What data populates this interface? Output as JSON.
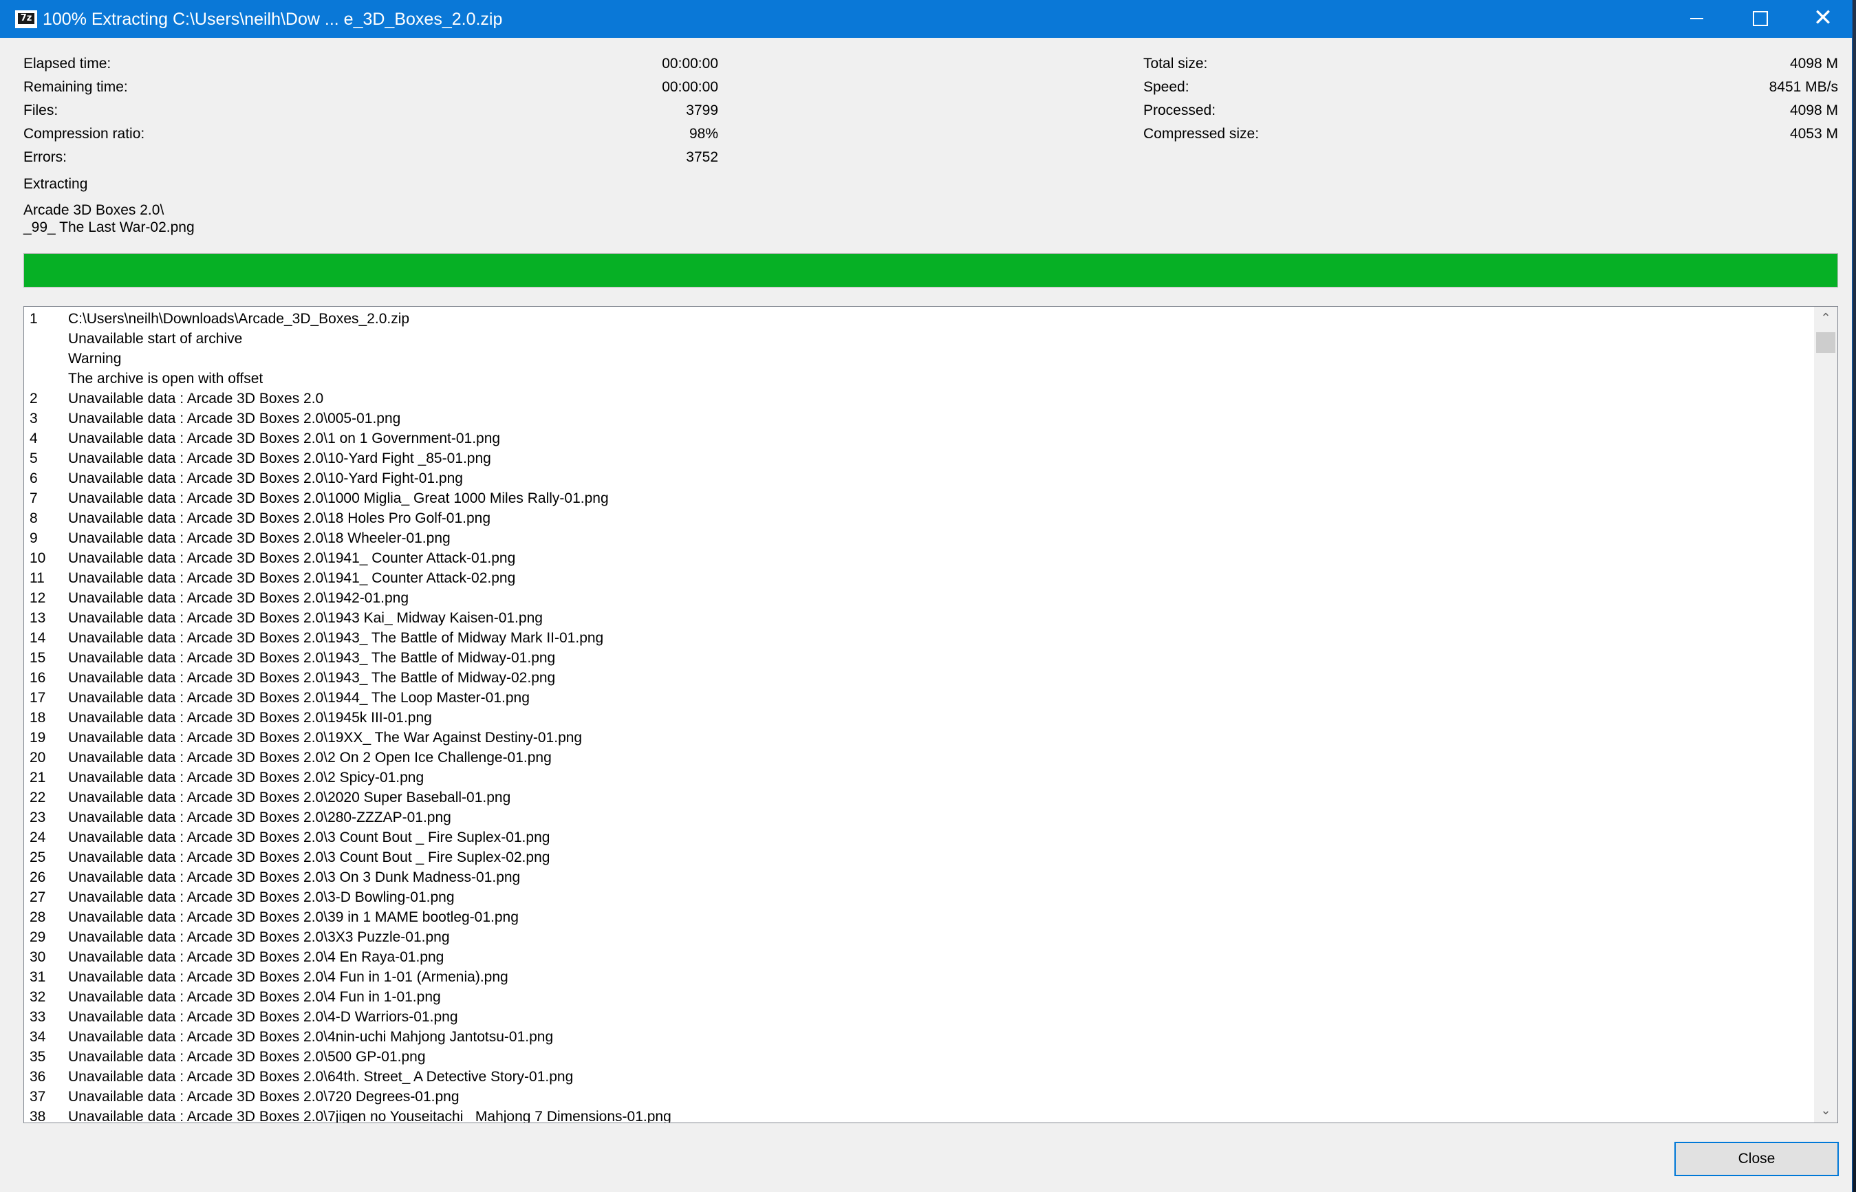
{
  "window": {
    "title": "100% Extracting C:\\Users\\neilh\\Dow ... e_3D_Boxes_2.0.zip",
    "app_icon_text": "7z",
    "icons": {
      "minimize": "minimize-icon",
      "maximize": "maximize-icon",
      "close": "close-icon"
    },
    "close_glyph": "✕"
  },
  "stats_left": [
    {
      "label": "Elapsed time:",
      "value": "00:00:00"
    },
    {
      "label": "Remaining time:",
      "value": "00:00:00"
    },
    {
      "label": "Files:",
      "value": "3799"
    },
    {
      "label": "Compression ratio:",
      "value": "98%"
    },
    {
      "label": "Errors:",
      "value": "3752"
    }
  ],
  "stats_right": [
    {
      "label": "Total size:",
      "value": "4098 M"
    },
    {
      "label": "Speed:",
      "value": "8451 MB/s"
    },
    {
      "label": "Processed:",
      "value": "4098 M"
    },
    {
      "label": "Compressed size:",
      "value": "4053 M"
    }
  ],
  "status": {
    "operation": "Extracting",
    "current_folder": "Arcade 3D Boxes 2.0\\",
    "current_file": "_99_ The Last War-02.png"
  },
  "progress": {
    "fraction": 1.0,
    "color": "#06b025"
  },
  "log": [
    {
      "num": "1",
      "msg": "C:\\Users\\neilh\\Downloads\\Arcade_3D_Boxes_2.0.zip"
    },
    {
      "num": "",
      "msg": "Unavailable start of archive"
    },
    {
      "num": "",
      "msg": "Warning"
    },
    {
      "num": "",
      "msg": "The archive is open with offset"
    },
    {
      "num": "2",
      "msg": "Unavailable data : Arcade 3D Boxes 2.0"
    },
    {
      "num": "3",
      "msg": "Unavailable data : Arcade 3D Boxes 2.0\\005-01.png"
    },
    {
      "num": "4",
      "msg": "Unavailable data : Arcade 3D Boxes 2.0\\1 on 1 Government-01.png"
    },
    {
      "num": "5",
      "msg": "Unavailable data : Arcade 3D Boxes 2.0\\10-Yard Fight _85-01.png"
    },
    {
      "num": "6",
      "msg": "Unavailable data : Arcade 3D Boxes 2.0\\10-Yard Fight-01.png"
    },
    {
      "num": "7",
      "msg": "Unavailable data : Arcade 3D Boxes 2.0\\1000 Miglia_ Great 1000 Miles Rally-01.png"
    },
    {
      "num": "8",
      "msg": "Unavailable data : Arcade 3D Boxes 2.0\\18 Holes Pro Golf-01.png"
    },
    {
      "num": "9",
      "msg": "Unavailable data : Arcade 3D Boxes 2.0\\18 Wheeler-01.png"
    },
    {
      "num": "10",
      "msg": "Unavailable data : Arcade 3D Boxes 2.0\\1941_ Counter Attack-01.png"
    },
    {
      "num": "11",
      "msg": "Unavailable data : Arcade 3D Boxes 2.0\\1941_ Counter Attack-02.png"
    },
    {
      "num": "12",
      "msg": "Unavailable data : Arcade 3D Boxes 2.0\\1942-01.png"
    },
    {
      "num": "13",
      "msg": "Unavailable data : Arcade 3D Boxes 2.0\\1943 Kai_ Midway Kaisen-01.png"
    },
    {
      "num": "14",
      "msg": "Unavailable data : Arcade 3D Boxes 2.0\\1943_ The Battle of Midway Mark II-01.png"
    },
    {
      "num": "15",
      "msg": "Unavailable data : Arcade 3D Boxes 2.0\\1943_ The Battle of Midway-01.png"
    },
    {
      "num": "16",
      "msg": "Unavailable data : Arcade 3D Boxes 2.0\\1943_ The Battle of Midway-02.png"
    },
    {
      "num": "17",
      "msg": "Unavailable data : Arcade 3D Boxes 2.0\\1944_ The Loop Master-01.png"
    },
    {
      "num": "18",
      "msg": "Unavailable data : Arcade 3D Boxes 2.0\\1945k III-01.png"
    },
    {
      "num": "19",
      "msg": "Unavailable data : Arcade 3D Boxes 2.0\\19XX_ The War Against Destiny-01.png"
    },
    {
      "num": "20",
      "msg": "Unavailable data : Arcade 3D Boxes 2.0\\2 On 2 Open Ice Challenge-01.png"
    },
    {
      "num": "21",
      "msg": "Unavailable data : Arcade 3D Boxes 2.0\\2 Spicy-01.png"
    },
    {
      "num": "22",
      "msg": "Unavailable data : Arcade 3D Boxes 2.0\\2020 Super Baseball-01.png"
    },
    {
      "num": "23",
      "msg": "Unavailable data : Arcade 3D Boxes 2.0\\280-ZZZAP-01.png"
    },
    {
      "num": "24",
      "msg": "Unavailable data : Arcade 3D Boxes 2.0\\3 Count Bout _ Fire Suplex-01.png"
    },
    {
      "num": "25",
      "msg": "Unavailable data : Arcade 3D Boxes 2.0\\3 Count Bout _ Fire Suplex-02.png"
    },
    {
      "num": "26",
      "msg": "Unavailable data : Arcade 3D Boxes 2.0\\3 On 3 Dunk Madness-01.png"
    },
    {
      "num": "27",
      "msg": "Unavailable data : Arcade 3D Boxes 2.0\\3-D Bowling-01.png"
    },
    {
      "num": "28",
      "msg": "Unavailable data : Arcade 3D Boxes 2.0\\39 in 1 MAME bootleg-01.png"
    },
    {
      "num": "29",
      "msg": "Unavailable data : Arcade 3D Boxes 2.0\\3X3 Puzzle-01.png"
    },
    {
      "num": "30",
      "msg": "Unavailable data : Arcade 3D Boxes 2.0\\4 En Raya-01.png"
    },
    {
      "num": "31",
      "msg": "Unavailable data : Arcade 3D Boxes 2.0\\4 Fun in 1-01 (Armenia).png"
    },
    {
      "num": "32",
      "msg": "Unavailable data : Arcade 3D Boxes 2.0\\4 Fun in 1-01.png"
    },
    {
      "num": "33",
      "msg": "Unavailable data : Arcade 3D Boxes 2.0\\4-D Warriors-01.png"
    },
    {
      "num": "34",
      "msg": "Unavailable data : Arcade 3D Boxes 2.0\\4nin-uchi Mahjong Jantotsu-01.png"
    },
    {
      "num": "35",
      "msg": "Unavailable data : Arcade 3D Boxes 2.0\\500 GP-01.png"
    },
    {
      "num": "36",
      "msg": "Unavailable data : Arcade 3D Boxes 2.0\\64th. Street_ A Detective Story-01.png"
    },
    {
      "num": "37",
      "msg": "Unavailable data : Arcade 3D Boxes 2.0\\720 Degrees-01.png"
    },
    {
      "num": "38",
      "msg": "Unavailable data : Arcade 3D Boxes 2.0\\7jigen no Youseitachi_ Mahjong 7 Dimensions-01.png"
    }
  ],
  "scrollbar": {
    "up_glyph": "⌃",
    "down_glyph": "⌄"
  },
  "buttons": {
    "close_label": "Close"
  }
}
